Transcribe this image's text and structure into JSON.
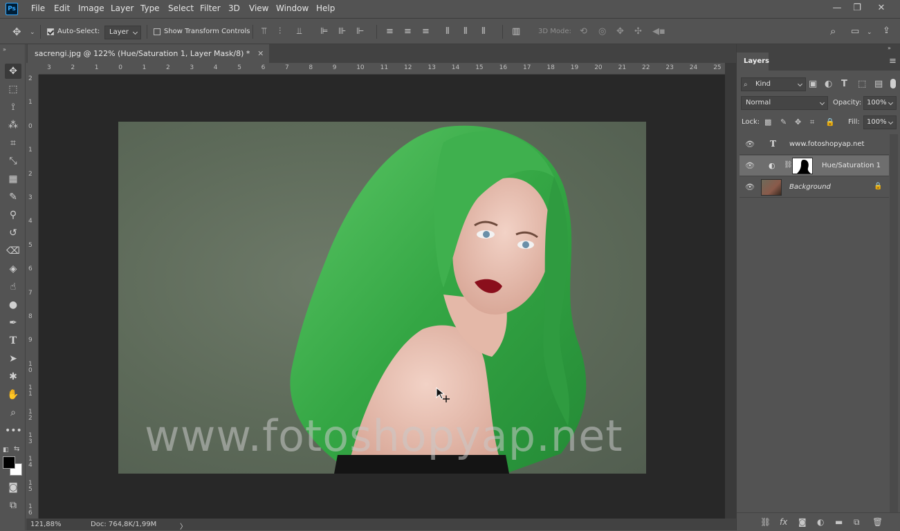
{
  "app": {
    "logo": "Ps"
  },
  "menu": [
    "File",
    "Edit",
    "Image",
    "Layer",
    "Type",
    "Select",
    "Filter",
    "3D",
    "View",
    "Window",
    "Help"
  ],
  "window_controls": {
    "minimize": "—",
    "restore": "❐",
    "close": "✕"
  },
  "options": {
    "auto_select_label": "Auto-Select:",
    "auto_select_value": "Layer",
    "show_transform_label": "Show Transform Controls",
    "mode_3d_label": "3D Mode:"
  },
  "document": {
    "tab_title": "sacrengi.jpg @ 122% (Hue/Saturation 1, Layer Mask/8) *",
    "close": "✕",
    "watermark": "www.fotoshopyap.net"
  },
  "ruler": {
    "top": [
      "3",
      "2",
      "1",
      "0",
      "1",
      "2",
      "3",
      "4",
      "5",
      "6",
      "7",
      "8",
      "9",
      "10",
      "11",
      "12",
      "13",
      "14",
      "15",
      "16",
      "17",
      "18",
      "19",
      "20",
      "21",
      "22",
      "23",
      "24",
      "25"
    ],
    "left": [
      "2",
      "1",
      "0",
      "1",
      "2",
      "3",
      "4",
      "5",
      "6",
      "7",
      "8",
      "9",
      "1 0",
      "1 1",
      "1 2",
      "1 3",
      "1 4",
      "1 5",
      "1 6"
    ]
  },
  "status": {
    "zoom": "121,88%",
    "doc": "Doc: 764,8K/1,99M",
    "arrow": "〉"
  },
  "layers_panel": {
    "tab": "Layers",
    "filter_kind": "Kind",
    "blend_mode": "Normal",
    "opacity_label": "Opacity:",
    "opacity_value": "100%",
    "lock_label": "Lock:",
    "fill_label": "Fill:",
    "fill_value": "100%",
    "layers": [
      {
        "name": "www.fotoshopyap.net",
        "type": "text",
        "icon": "T"
      },
      {
        "name": "Hue/Saturation 1",
        "type": "adjustment",
        "selected": true
      },
      {
        "name": "Background",
        "type": "image",
        "locked": true
      }
    ]
  },
  "colors": {
    "hair": "#3fae4c",
    "background": "#5f6b5a",
    "ui_dark": "#282828",
    "ui_panel": "#535353"
  }
}
